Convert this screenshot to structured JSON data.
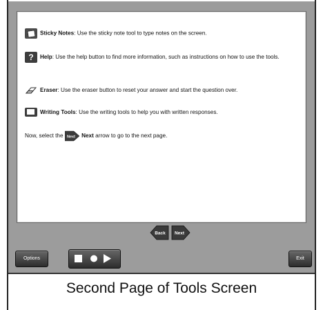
{
  "tools": [
    {
      "name": "Sticky Notes",
      "desc": ": Use the sticky note tool to type notes on the screen.",
      "icon": "sticky-notes-icon"
    },
    {
      "name": "Help",
      "desc": ": Use the help button to find more information, such as instructions on how to use the tools.",
      "icon": "help-icon"
    },
    {
      "name": "Eraser",
      "desc": ": Use the eraser button to reset your answer and start the question over.",
      "icon": "eraser-icon"
    },
    {
      "name": "Writing Tools",
      "desc": ": Use the writing tools to help you with written responses.",
      "icon": "writing-tools-icon"
    }
  ],
  "help_glyph": "?",
  "instruction": {
    "prefix": "Now, select the",
    "next_word": "Next",
    "suffix": "arrow to go to the next page."
  },
  "nav": {
    "back_label": "Back",
    "next_label": "Next"
  },
  "bottom": {
    "options_label": "Options",
    "exit_label": "Exit"
  },
  "caption": "Second Page of Tools Screen",
  "colors": {
    "frame_gray": "#9c9c9c",
    "button_dark": "#2d2d2d"
  }
}
